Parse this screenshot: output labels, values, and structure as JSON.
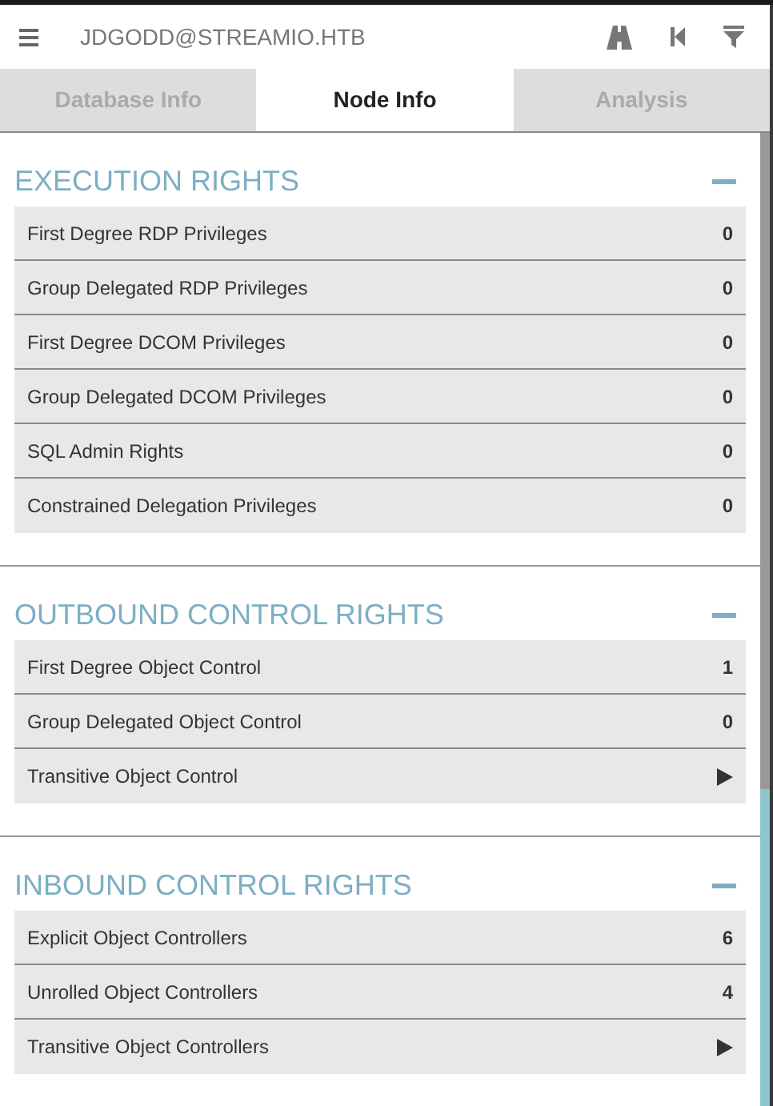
{
  "header": {
    "title": "JDGODD@STREAMIO.HTB"
  },
  "tabs": [
    {
      "label": "Database Info",
      "selected": false
    },
    {
      "label": "Node Info",
      "selected": true
    },
    {
      "label": "Analysis",
      "selected": false
    }
  ],
  "sections": [
    {
      "title": "EXECUTION RIGHTS",
      "rows": [
        {
          "kind": "count",
          "label": "First Degree RDP Privileges",
          "value": "0"
        },
        {
          "kind": "count",
          "label": "Group Delegated RDP Privileges",
          "value": "0"
        },
        {
          "kind": "count",
          "label": "First Degree DCOM Privileges",
          "value": "0"
        },
        {
          "kind": "count",
          "label": "Group Delegated DCOM Privileges",
          "value": "0"
        },
        {
          "kind": "count",
          "label": "SQL Admin Rights",
          "value": "0"
        },
        {
          "kind": "count",
          "label": "Constrained Delegation Privileges",
          "value": "0"
        }
      ]
    },
    {
      "title": "OUTBOUND CONTROL RIGHTS",
      "rows": [
        {
          "kind": "count",
          "label": "First Degree Object Control",
          "value": "1"
        },
        {
          "kind": "count",
          "label": "Group Delegated Object Control",
          "value": "0"
        },
        {
          "kind": "expand",
          "label": "Transitive Object Control"
        }
      ]
    },
    {
      "title": "INBOUND CONTROL RIGHTS",
      "rows": [
        {
          "kind": "count",
          "label": "Explicit Object Controllers",
          "value": "6"
        },
        {
          "kind": "count",
          "label": "Unrolled Object Controllers",
          "value": "4"
        },
        {
          "kind": "expand",
          "label": "Transitive Object Controllers"
        }
      ]
    }
  ]
}
